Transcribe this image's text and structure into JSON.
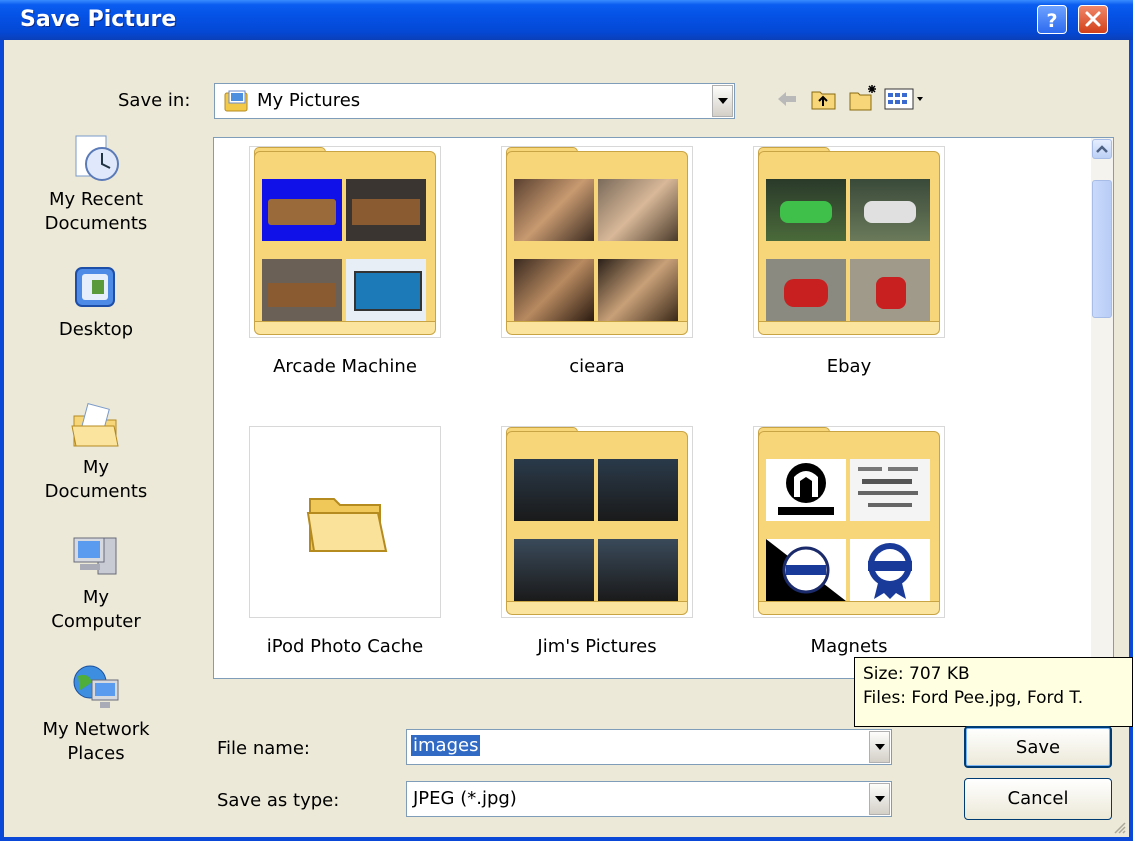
{
  "window": {
    "title": "Save Picture"
  },
  "save_in": {
    "label": "Save in:",
    "value": "My Pictures"
  },
  "toolbar": {
    "icons": [
      "back-icon",
      "up-folder-icon",
      "new-folder-icon",
      "views-menu-icon"
    ]
  },
  "places": [
    {
      "label_line1": "My Recent",
      "label_line2": "Documents",
      "icon": "recent-documents-icon"
    },
    {
      "label_line1": "Desktop",
      "label_line2": "",
      "icon": "desktop-icon"
    },
    {
      "label_line1": "My Documents",
      "label_line2": "",
      "icon": "my-documents-icon"
    },
    {
      "label_line1": "My Computer",
      "label_line2": "",
      "icon": "my-computer-icon"
    },
    {
      "label_line1": "My Network",
      "label_line2": "Places",
      "icon": "network-places-icon"
    }
  ],
  "files": [
    {
      "name": "Arcade Machine"
    },
    {
      "name": "cieara"
    },
    {
      "name": "Ebay"
    },
    {
      "name": "iPod Photo Cache"
    },
    {
      "name": "Jim's Pictures"
    },
    {
      "name": "Magnets"
    }
  ],
  "tooltip": {
    "size": "Size: 707 KB",
    "files": "Files: Ford Pee.jpg, Ford T."
  },
  "filename": {
    "label": "File name:",
    "value": "images"
  },
  "filetype": {
    "label": "Save as type:",
    "value": "JPEG (*.jpg)"
  },
  "buttons": {
    "save": "Save",
    "cancel": "Cancel"
  },
  "colors": {
    "titlebar": "#0552e6",
    "dialog_bg": "#ece9d8",
    "selection": "#316ac5",
    "tooltip_bg": "#ffffe1",
    "folder": "#f7d67a"
  }
}
